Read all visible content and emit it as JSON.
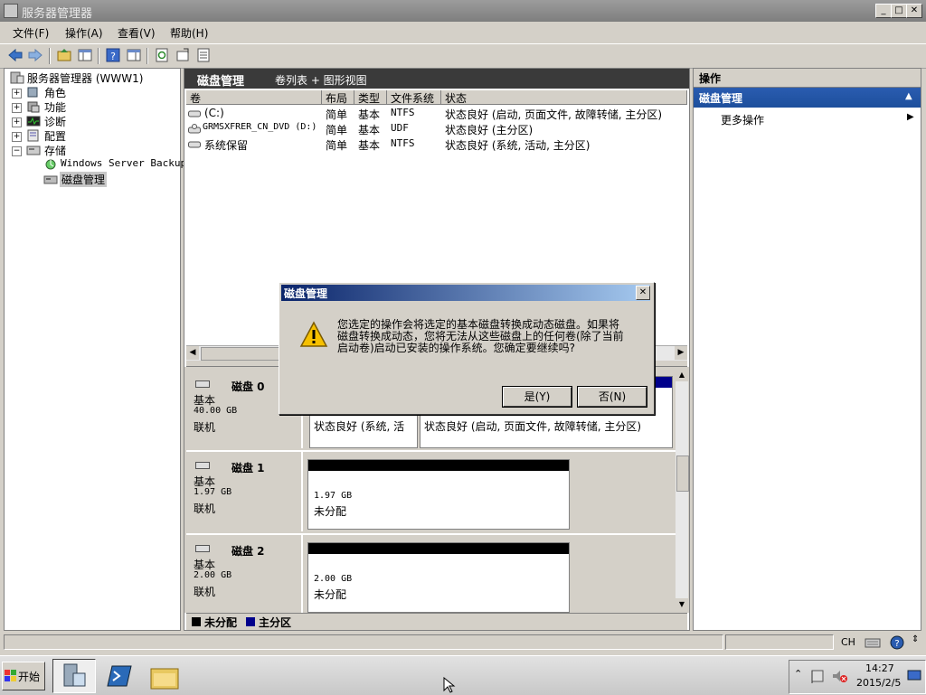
{
  "window": {
    "title": "服务器管理器"
  },
  "menu": [
    "文件(F)",
    "操作(A)",
    "查看(V)",
    "帮助(H)"
  ],
  "tree": {
    "root": "服务器管理器 (WWW1)",
    "items": [
      "角色",
      "功能",
      "诊断",
      "配置",
      "存储"
    ],
    "storage_children": [
      "Windows Server Backup",
      "磁盘管理"
    ]
  },
  "center": {
    "header_title": "磁盘管理",
    "header_view": "卷列表 + 图形视图",
    "columns": [
      "卷",
      "布局",
      "类型",
      "文件系统",
      "状态"
    ],
    "volumes": [
      {
        "name": "(C:)",
        "layout": "简单",
        "type": "基本",
        "fs": "NTFS",
        "status": "状态良好 (启动, 页面文件, 故障转储, 主分区)"
      },
      {
        "name": "GRMSXFRER_CN_DVD (D:)",
        "layout": "简单",
        "type": "基本",
        "fs": "UDF",
        "status": "状态良好 (主分区)"
      },
      {
        "name": "系统保留",
        "layout": "简单",
        "type": "基本",
        "fs": "NTFS",
        "status": "状态良好 (系统, 活动, 主分区)"
      }
    ],
    "disks": [
      {
        "name": "磁盘 0",
        "type": "基本",
        "size": "40.00 GB",
        "state": "联机",
        "vol1": "状态良好 (系统, 活",
        "vol2": "状态良好 (启动, 页面文件, 故障转储, 主分区)"
      },
      {
        "name": "磁盘 1",
        "type": "基本",
        "size": "1.97 GB",
        "state": "联机",
        "vsize": "1.97 GB",
        "vstate": "未分配"
      },
      {
        "name": "磁盘 2",
        "type": "基本",
        "size": "2.00 GB",
        "state": "联机",
        "vsize": "2.00 GB",
        "vstate": "未分配"
      }
    ],
    "legend": [
      "未分配",
      "主分区"
    ]
  },
  "actions": {
    "title": "操作",
    "section": "磁盘管理",
    "more": "更多操作"
  },
  "dialog": {
    "title": "磁盘管理",
    "line1": "您选定的操作会将选定的基本磁盘转换成动态磁盘。如果将",
    "line2": "磁盘转换成动态，您将无法从这些磁盘上的任何卷(除了当前",
    "line3": "启动卷)启动已安装的操作系统。您确定要继续吗?",
    "yes": "是(Y)",
    "no": "否(N)"
  },
  "statusbar": {
    "lang": "CH"
  },
  "taskbar": {
    "start": "开始",
    "time": "14:27",
    "date": "2015/2/5"
  },
  "colors": {
    "selection": "#0a246a",
    "unallocated": "#000000",
    "primary": "#00008b",
    "header_dark": "#3a3a3a",
    "actions_header": "#1d4f9c"
  }
}
